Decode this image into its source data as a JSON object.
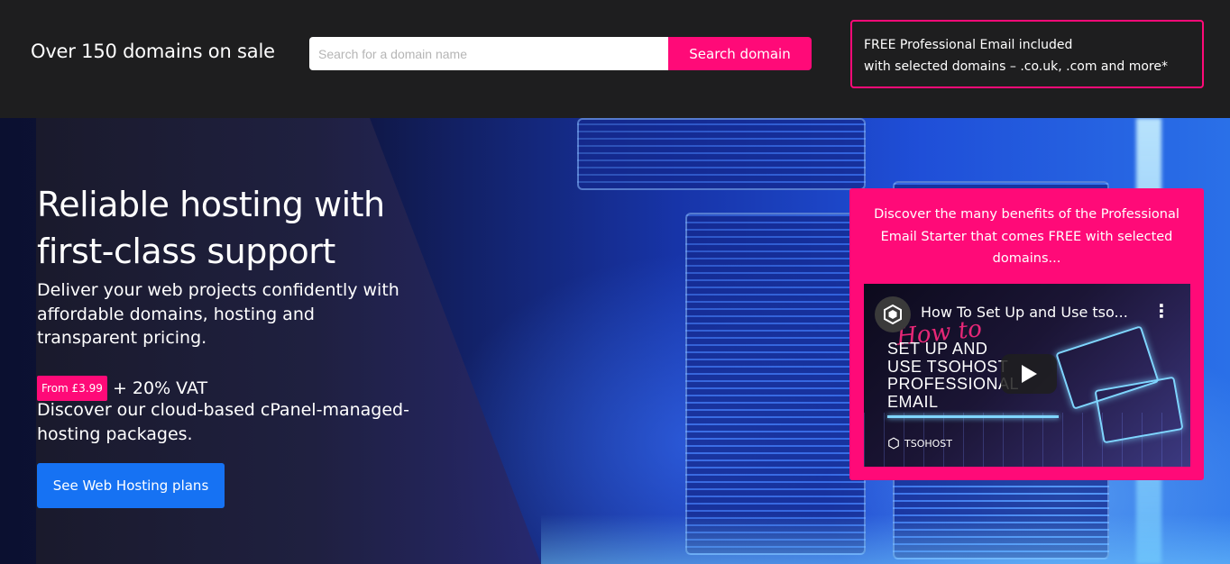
{
  "topbar": {
    "title": "Over 150 domains on sale",
    "search": {
      "placeholder": "Search for a domain name",
      "value": "",
      "button_label": "Search domain"
    },
    "promo": {
      "line1": "FREE Professional Email included",
      "line2": "with selected domains – .co.uk, .com and more*"
    }
  },
  "hero": {
    "heading": "Reliable hosting with first-class support",
    "subheading": "Deliver your web projects confidently with affordable domains, hosting and transparent pricing.",
    "price_badge": "From £3.99",
    "price_suffix": "+ 20% VAT",
    "description": "Discover our cloud-based cPanel-managed-hosting packages.",
    "cta_label": "See Web Hosting plans"
  },
  "video_card": {
    "text": "Discover the many benefits of the Professional Email Starter that comes FREE with selected domains...",
    "video": {
      "title": "How To Set Up and Use tso...",
      "script_overlay": "How to",
      "thumb_lines": [
        "SET UP AND",
        "USE TSOHOST",
        "PROFESSIONAL",
        "EMAIL"
      ],
      "brand": "TSOHOST"
    }
  },
  "colors": {
    "accent_pink": "#ff0a78",
    "primary_blue": "#1672f3",
    "topbar_bg": "#1e1e1f"
  },
  "icons": [
    "tsohost-logo-icon",
    "more-vert-icon",
    "play-icon",
    "envelope-icon"
  ]
}
